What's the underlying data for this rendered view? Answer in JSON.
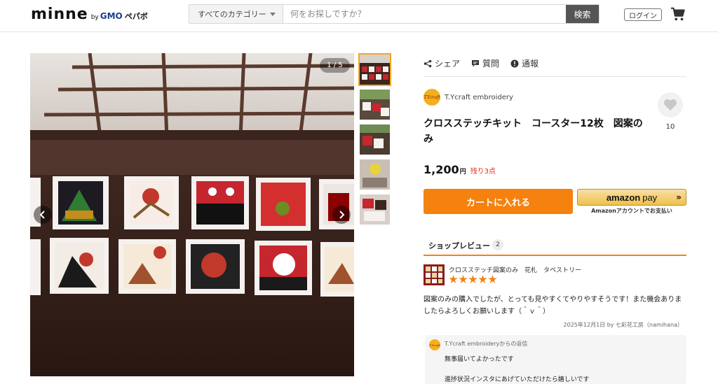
{
  "header": {
    "logo_main": "minne",
    "logo_by": "by",
    "logo_gmo": "GMO",
    "logo_pepabo": "ペパボ",
    "category_label": "すべてのカテゴリー",
    "search_placeholder": "何をお探しですか？",
    "search_button": "検索",
    "login_label": "ログイン"
  },
  "gallery": {
    "counter": "1 / 5",
    "thumbnail_count": 5,
    "active_thumbnail": 1
  },
  "actions": {
    "share": "シェア",
    "question": "質問",
    "report": "通報"
  },
  "shop": {
    "avatar_text": "T.Ycraft",
    "name": "T.Ycraft embroidery"
  },
  "product": {
    "title": "クロスステッチキット　コースター12枚　図案のみ",
    "price": "1,200",
    "currency": "円",
    "stock": "残り3点",
    "favorites": "10"
  },
  "purchase": {
    "cart_button": "カートに入れる",
    "amazon_main": "amazon",
    "amazon_pay": "pay",
    "amazon_chevron": "»",
    "amazon_sub": "Amazonアカウントでお支払い"
  },
  "reviews": {
    "tab_label": "ショップレビュー",
    "count": "2",
    "items": [
      {
        "product": "クロスステッチ図案のみ　花札　タペストリー",
        "rating": 5,
        "text": "図案のみの購入でしたが、とっても見やすくてやりやすそうです！また機会ありましたらよろしくお願いします（＾ｖ＾）",
        "meta": "2025年12月1日  by 七彩花工房（namihana）",
        "reply": {
          "header": "T.Ycraft embroideryからの返信",
          "line1": "無事届いてよかったです",
          "line2": "進捗状況インスタにあげていただけたら嬉しいです"
        }
      }
    ]
  },
  "colors": {
    "accent_orange": "#f5810f",
    "stock_red": "#e0321b",
    "search_button": "#555555",
    "amazon_yellow": "#f0c14b"
  }
}
